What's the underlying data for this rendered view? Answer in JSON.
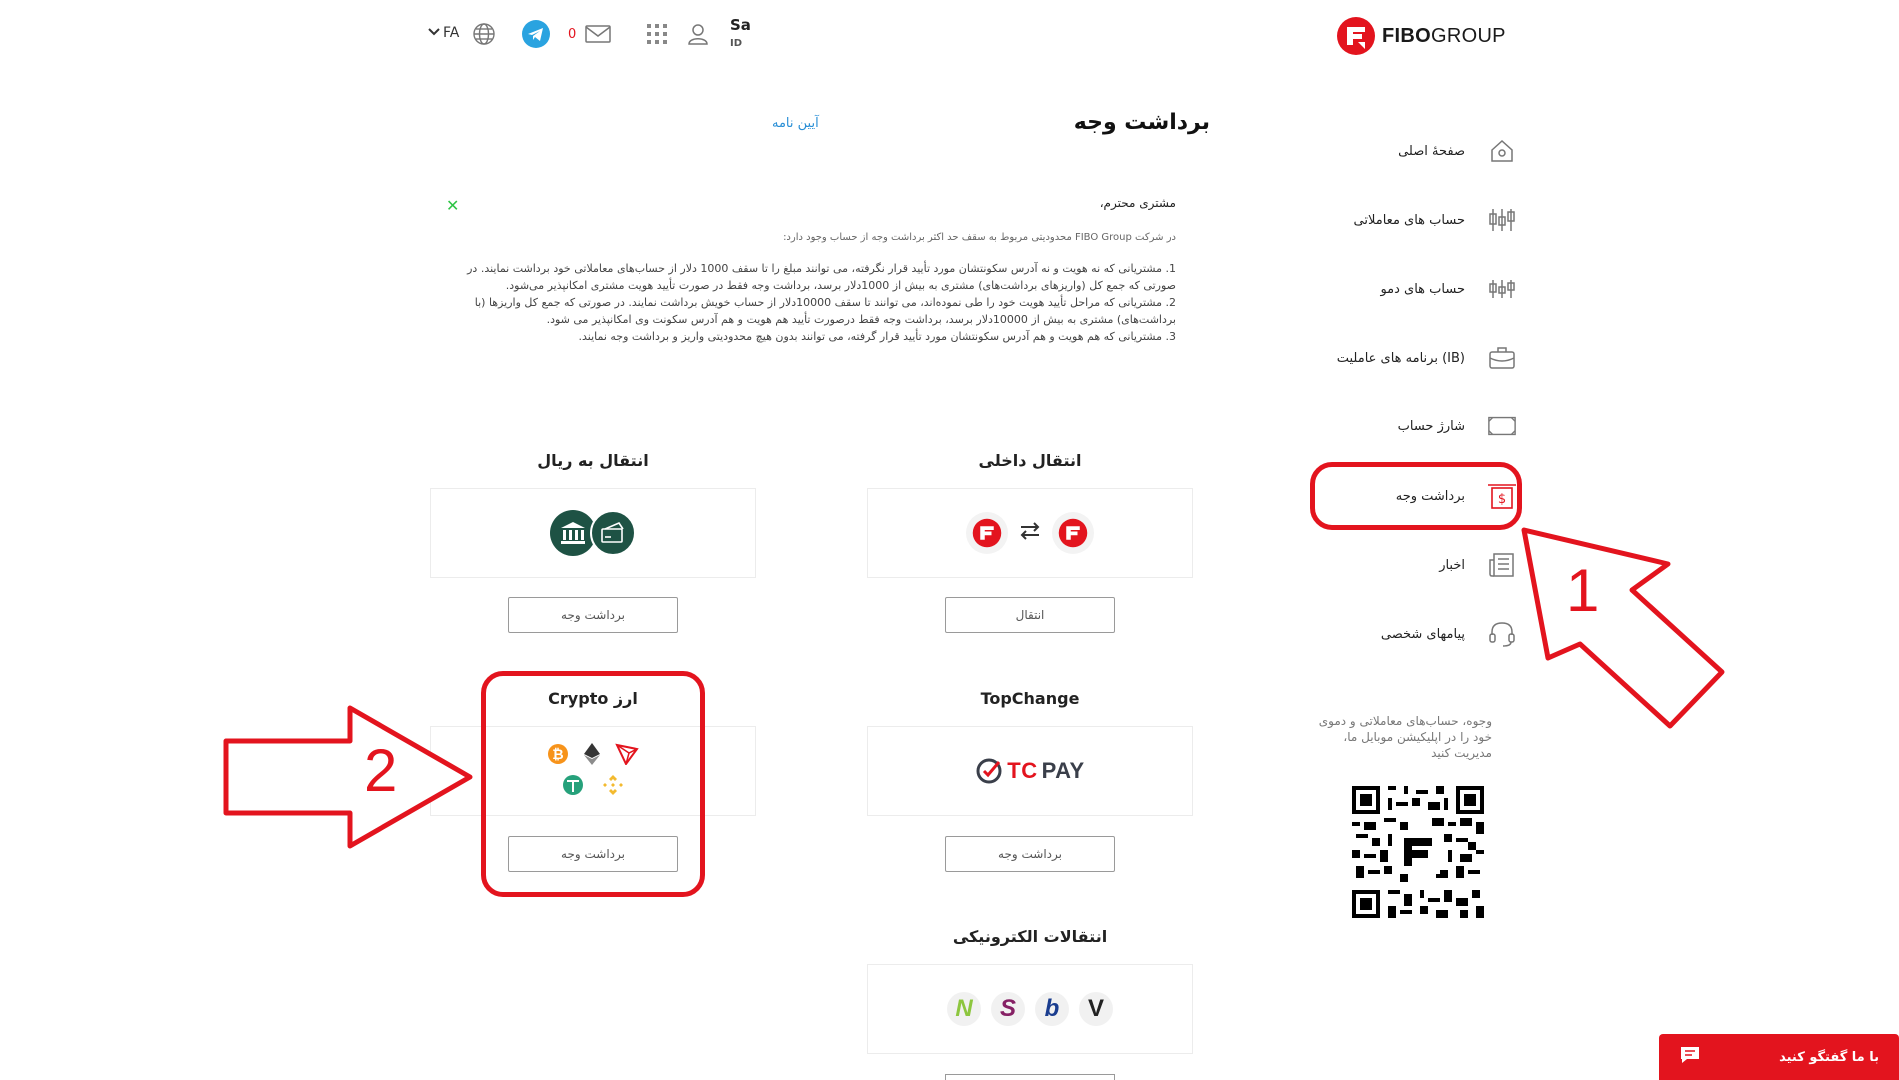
{
  "header": {
    "brand_bold": "FIBO",
    "brand_rest": "GROUP",
    "user_name": "Sa",
    "user_id": "ID",
    "message_count": "0",
    "language": "FA",
    "icons": [
      "user-icon",
      "apps-grid-icon",
      "mail-icon",
      "telegram-icon",
      "globe-icon",
      "chevron-down-icon"
    ]
  },
  "sidebar": {
    "items": [
      {
        "label": "صفحهٔ اصلی",
        "icon": "home-icon"
      },
      {
        "label": "حساب های معاملاتی",
        "icon": "candlestick-icon"
      },
      {
        "label": "حساب های دمو",
        "icon": "demo-candlestick-icon"
      },
      {
        "label": "برنامه های عاملیت (IB)",
        "icon": "briefcase-icon"
      },
      {
        "label": "شارژ حساب",
        "icon": "deposit-icon"
      },
      {
        "label": "برداشت وجه",
        "icon": "withdraw-icon"
      },
      {
        "label": "اخبار",
        "icon": "news-icon"
      },
      {
        "label": "پیامهای شخصی",
        "icon": "headset-icon"
      }
    ],
    "app_text": "وجوه، حساب‌های معاملاتی و دموی خود را در اپلیکیشن موبایل ما، مدیریت کنید"
  },
  "main": {
    "title": "برداشت وجه",
    "rules_link": "آیین نامه",
    "notice": {
      "greeting": "مشتری محترم،",
      "intro": "در شرکت FIBO Group محدودیتی مربوط به سقف حد اکثر برداشت وجه از حساب وجود دارد:",
      "items": [
        "1. مشتریانی که نه هویت و نه آدرس سکونتشان مورد تأیید قرار نگرفته، می توانند مبلغ را تا سقف 1000 دلار از حساب‌های معاملاتی خود برداشت نمایند. در صورتی که جمع کل (واریزهای برداشت‌های) مشتری به بیش از 1000دلار برسد، برداشت وجه فقط در صورت تأیید هویت مشتری امکانپذیر می‌شود.",
        "2. مشتریانی که مراحل تأیید هویت خود را طی نموده‌اند، می توانند تا سقف 10000دلار از حساب خویش برداشت نمایند. در صورتی که جمع کل واریزها (با برداشت‌های) مشتری به بیش از 10000دلار برسد، برداشت وجه فقط درصورت تأیید هم هویت و هم آدرس سکونت وی امکانپذیر می شود.",
        "3. مشتریانی که هم هویت و هم آدرس سکونتشان مورد تأیید قرار گرفته، می توانند بدون هیچ محدودیتی واریز و برداشت وجه نمایند."
      ]
    },
    "sections": {
      "internal": {
        "title": "انتقال داخلی",
        "button": "انتقال"
      },
      "rial": {
        "title": "انتقال به ریال",
        "button": "برداشت وجه"
      },
      "topchange": {
        "title": "TopChange",
        "button": "برداشت وجه",
        "logo_tc": "TC",
        "logo_pay": "PAY"
      },
      "crypto": {
        "title": "Crypto ارز",
        "button": "برداشت وجه",
        "coins": [
          "bitcoin-icon",
          "ethereum-icon",
          "tron-icon",
          "tether-icon",
          "binance-icon"
        ]
      },
      "electronic": {
        "title": "انتقالات الکترونیکی",
        "letters": [
          "N",
          "S",
          "b",
          "V"
        ]
      }
    }
  },
  "annotations": {
    "step1": "1",
    "step2": "2"
  },
  "chat": {
    "label": "با ما گفتگو کنید"
  },
  "colors": {
    "brand_red": "#e3141e",
    "dark_green": "#1e5244",
    "link_blue": "#2a8fd6"
  }
}
